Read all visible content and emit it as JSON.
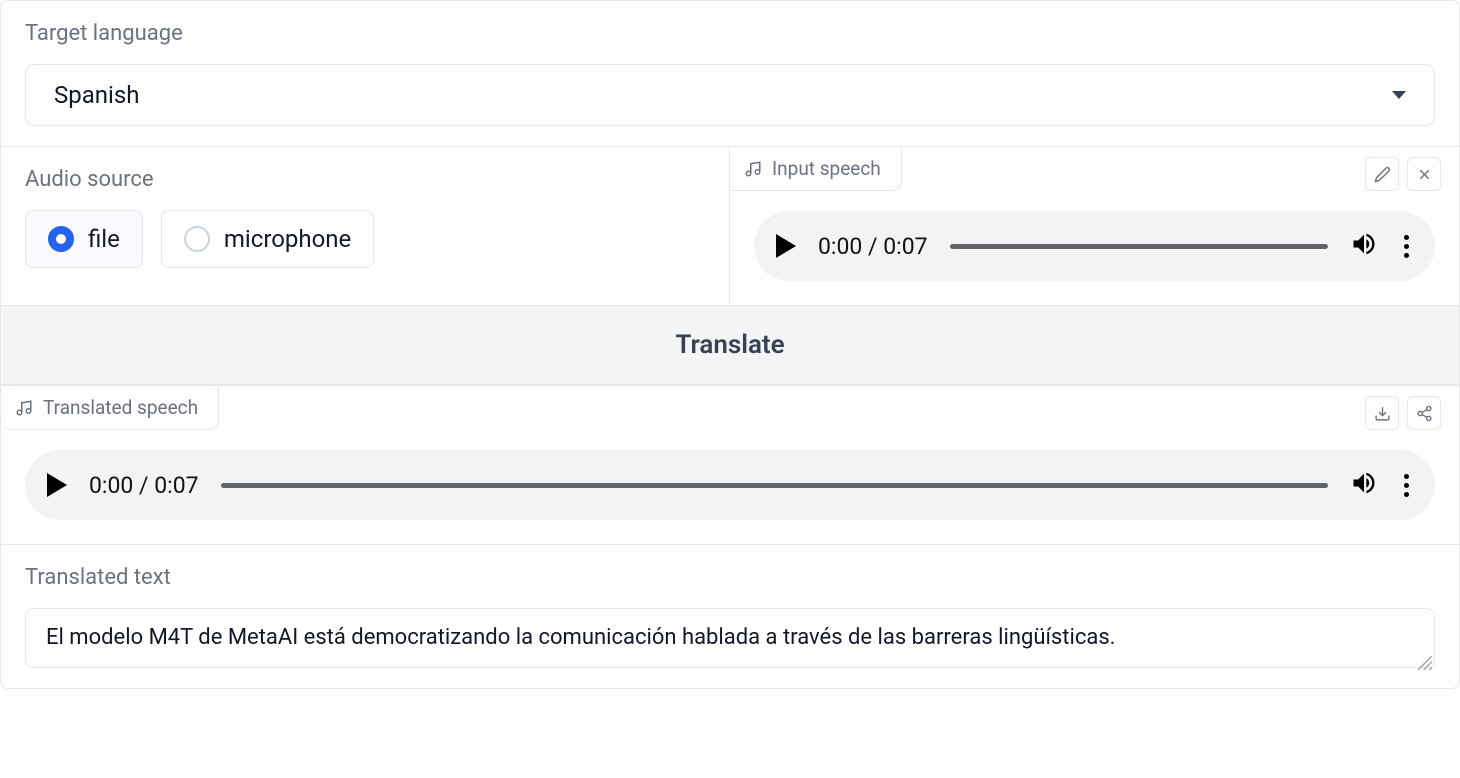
{
  "target_language": {
    "label": "Target language",
    "selected": "Spanish"
  },
  "audio_source": {
    "label": "Audio source",
    "options": {
      "file": "file",
      "microphone": "microphone"
    },
    "selected": "file"
  },
  "input_speech": {
    "label": "Input speech",
    "time": "0:00 / 0:07"
  },
  "translate_button": "Translate",
  "translated_speech": {
    "label": "Translated speech",
    "time": "0:00 / 0:07"
  },
  "translated_text": {
    "label": "Translated text",
    "value": "El modelo M4T de MetaAI está democratizando la comunicación hablada a través de las barreras lingüísticas."
  }
}
